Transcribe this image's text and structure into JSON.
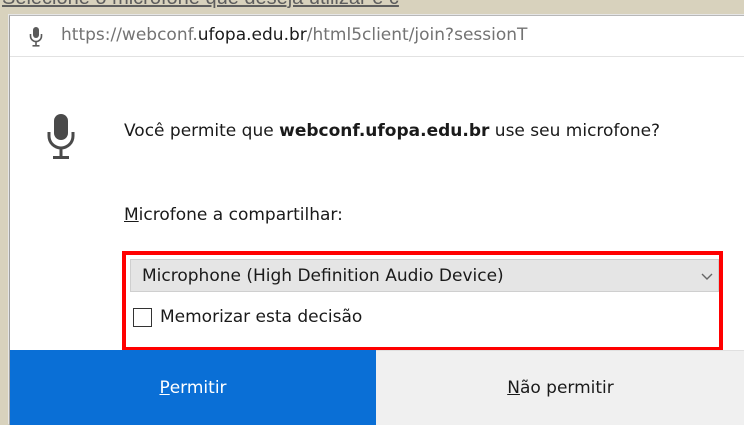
{
  "caption": "Selecione o microfone que deseja utilizar e c",
  "urlbar": {
    "url_prefix": "https://webconf.",
    "url_host": "ufopa.edu.br",
    "url_path": "/html5client/join?sessionT",
    "icon": "microphone-icon"
  },
  "dialog": {
    "icon": "microphone-icon",
    "prompt_before": "Você permite que ",
    "prompt_site": "webconf.ufopa.edu.br",
    "prompt_after": " use seu microfone?",
    "share_label_accel": "M",
    "share_label_rest": "icrofone a compartilhar:",
    "select_value": "Microphone (High Definition Audio Device)",
    "remember_label": "Memorizar esta decisão",
    "remember_checked": false
  },
  "buttons": {
    "allow_accel": "P",
    "allow_rest": "ermitir",
    "deny_accel": "N",
    "deny_rest": "ão permitir"
  },
  "colors": {
    "allow_bg": "#0a6fd6",
    "highlight": "#ff0000"
  }
}
